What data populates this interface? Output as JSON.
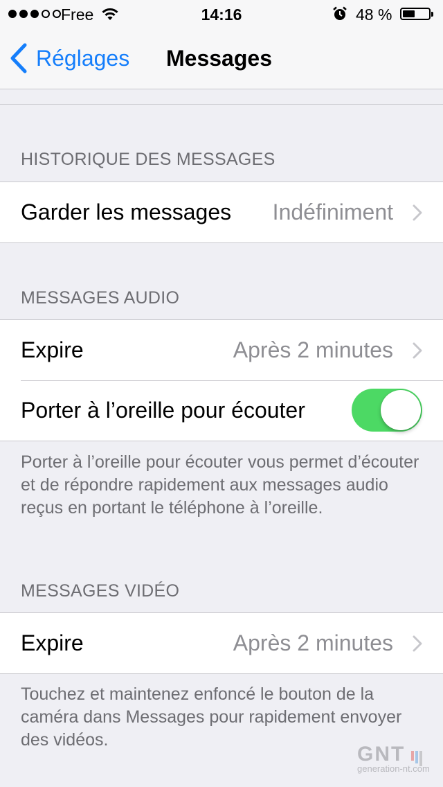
{
  "status_bar": {
    "signal_dots": [
      true,
      true,
      true,
      false,
      false
    ],
    "carrier": "Free",
    "time": "14:16",
    "battery_percent": "48 %",
    "battery_level": 0.48
  },
  "nav": {
    "back_label": "Réglages",
    "title": "Messages",
    "accent_color": "#157efb"
  },
  "sections": {
    "history": {
      "header": "HISTORIQUE DES MESSAGES",
      "keep_label": "Garder les messages",
      "keep_value": "Indéfiniment"
    },
    "audio": {
      "header": "MESSAGES AUDIO",
      "expire_label": "Expire",
      "expire_value": "Après 2 minutes",
      "raise_label": "Porter à l’oreille pour écouter",
      "raise_enabled": true,
      "footer": "Porter à l’oreille pour écouter vous permet d’écouter et de répondre rapidement aux messages audio reçus en portant le téléphone à l’oreille."
    },
    "video": {
      "header": "MESSAGES VIDÉO",
      "expire_label": "Expire",
      "expire_value": "Après 2 minutes",
      "footer": "Touchez et maintenez enfoncé le bouton de la caméra dans Messages pour rapidement envoyer des vidéos."
    }
  },
  "watermark": {
    "logo": "GNT",
    "url": "generation-nt.com"
  },
  "colors": {
    "toggle_on": "#4cd964",
    "background": "#efeff4"
  }
}
